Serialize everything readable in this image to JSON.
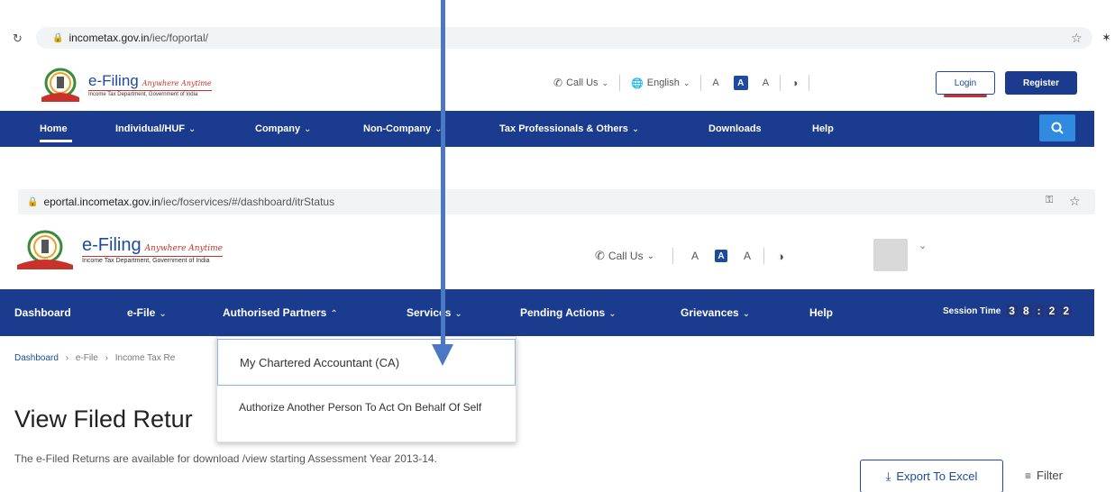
{
  "top_browser": {
    "url_host": "incometax.gov.in",
    "url_path": "/iec/foportal/"
  },
  "top_site": {
    "brand_title": "e-Filing",
    "brand_tag": "Anywhere Anytime",
    "brand_sub": "Income Tax Department, Government of India",
    "call_us": "Call Us",
    "language": "English",
    "font_decrease": "A",
    "font_normal": "A",
    "font_increase": "A",
    "login": "Login",
    "register": "Register",
    "nav": [
      {
        "label": "Home"
      },
      {
        "label": "Individual/HUF"
      },
      {
        "label": "Company"
      },
      {
        "label": "Non-Company"
      },
      {
        "label": "Tax Professionals & Others"
      },
      {
        "label": "Downloads"
      },
      {
        "label": "Help"
      }
    ]
  },
  "bottom_browser": {
    "url_host": "eportal.incometax.gov.in",
    "url_path": "/iec/foservices/#/dashboard/itrStatus"
  },
  "bottom_site": {
    "brand_title": "e-Filing",
    "brand_tag": "Anywhere Anytime",
    "brand_sub": "Income Tax Department, Government of India",
    "call_us": "Call Us",
    "font_decrease": "A",
    "font_normal": "A",
    "font_increase": "A",
    "nav": [
      {
        "label": "Dashboard"
      },
      {
        "label": "e-File"
      },
      {
        "label": "Authorised Partners"
      },
      {
        "label": "Services"
      },
      {
        "label": "Pending Actions"
      },
      {
        "label": "Grievances"
      },
      {
        "label": "Help"
      }
    ],
    "session_label": "Session Time",
    "session_digits": [
      "3",
      "8",
      ":",
      "2",
      "2"
    ]
  },
  "dropdown": {
    "items": [
      {
        "label": "My Chartered Accountant (CA)"
      },
      {
        "label": "Authorize Another Person To Act On Behalf Of Self"
      }
    ]
  },
  "breadcrumb": {
    "home": "Dashboard",
    "efile": "e-File",
    "current": "Income Tax Re"
  },
  "page": {
    "title": "View Filed Retur",
    "description": "The e-Filed Returns are available for download /view starting Assessment Year 2013-14.",
    "export_label": "Export To Excel",
    "filter_label": "Filter"
  },
  "colors": {
    "nav_bg": "#1b3b8f",
    "brand_blue": "#1d4aa0",
    "brand_red": "#c8322a",
    "arrow": "#4a78c2"
  }
}
